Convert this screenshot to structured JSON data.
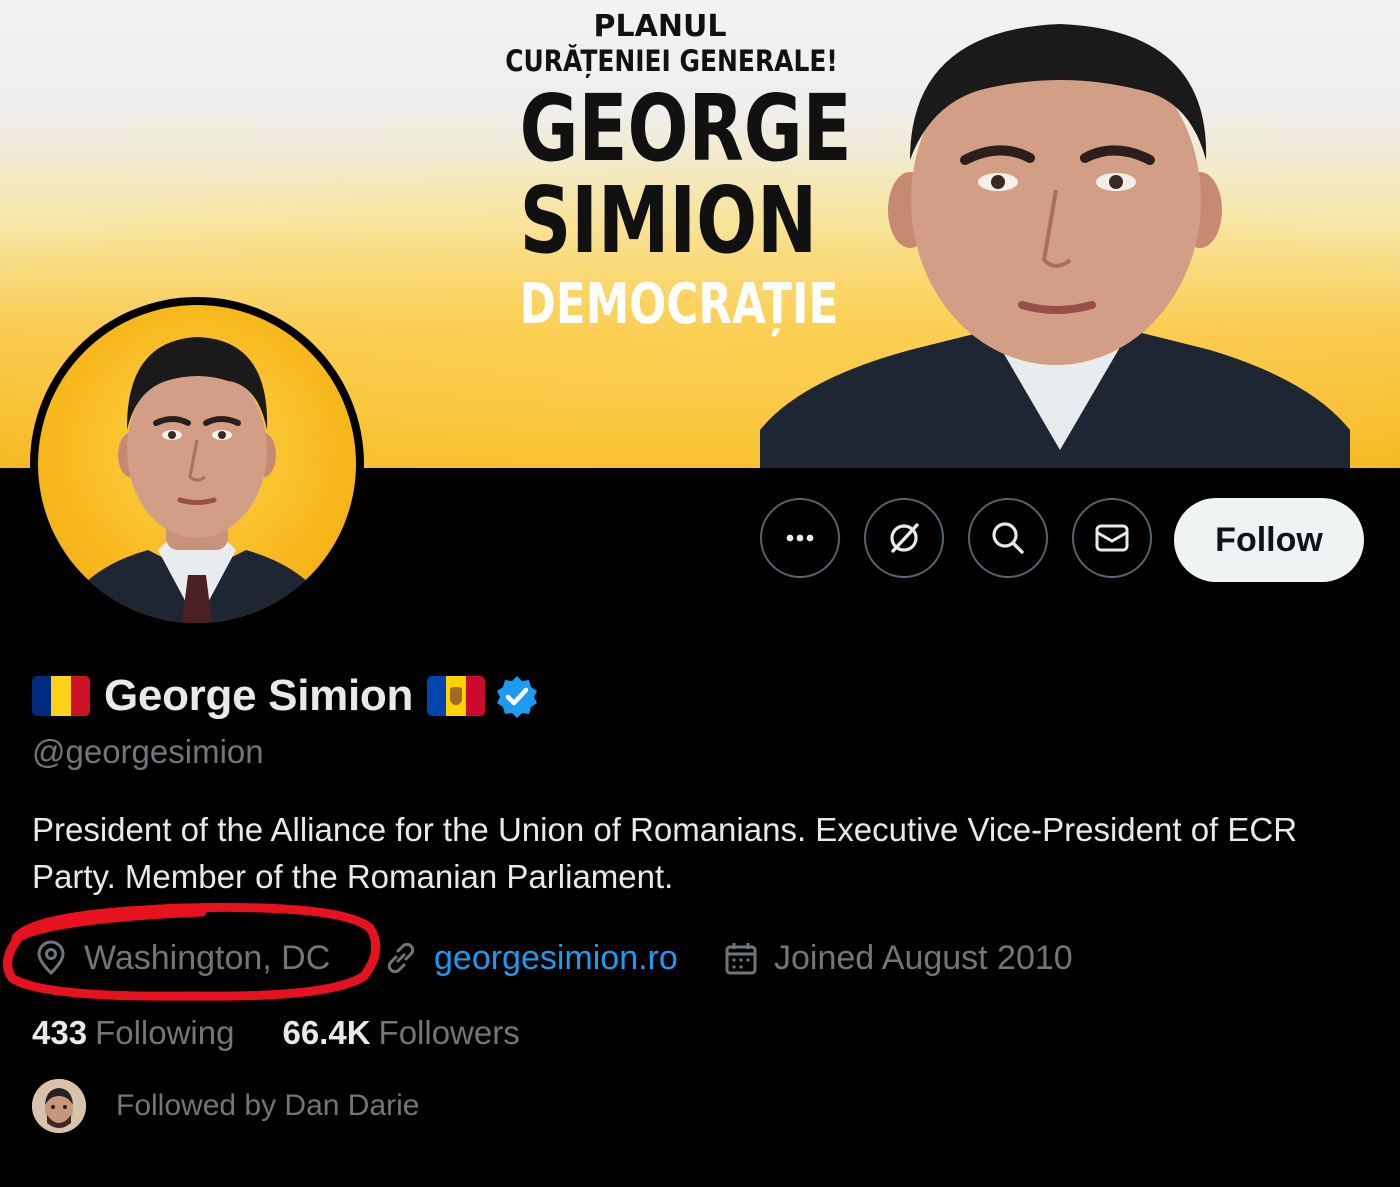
{
  "banner": {
    "line1": "PLANUL",
    "line2": "CURĂȚENIEI GENERALE!",
    "name_first": "GEORGE",
    "name_last": "SIMION",
    "party": "DEMOCRAȚIE"
  },
  "profile": {
    "display_name": "George Simion",
    "handle": "@georgesimion",
    "bio": "President of the Alliance for the Union of Romanians. Executive Vice-President of ECR Party. Member of the Romanian Parliament.",
    "location": "Washington, DC",
    "website": "georgesimion.ro",
    "joined": "Joined August 2010",
    "verified": true
  },
  "stats": {
    "following_count": "433",
    "following_label": "Following",
    "followers_count": "66.4K",
    "followers_label": "Followers"
  },
  "followed_by": "Followed by Dan Darie",
  "actions": {
    "more_icon": "more-icon",
    "grok_icon": "grok-icon",
    "search_icon": "search-icon",
    "message_icon": "message-icon",
    "follow_label": "Follow"
  },
  "colors": {
    "background": "#000000",
    "text_primary": "#e7e9ea",
    "text_secondary": "#71767b",
    "link": "#1d9bf0",
    "verified": "#1d9bf0",
    "annotation_red": "#e8121e",
    "banner_yellow": "#f5b91f"
  }
}
